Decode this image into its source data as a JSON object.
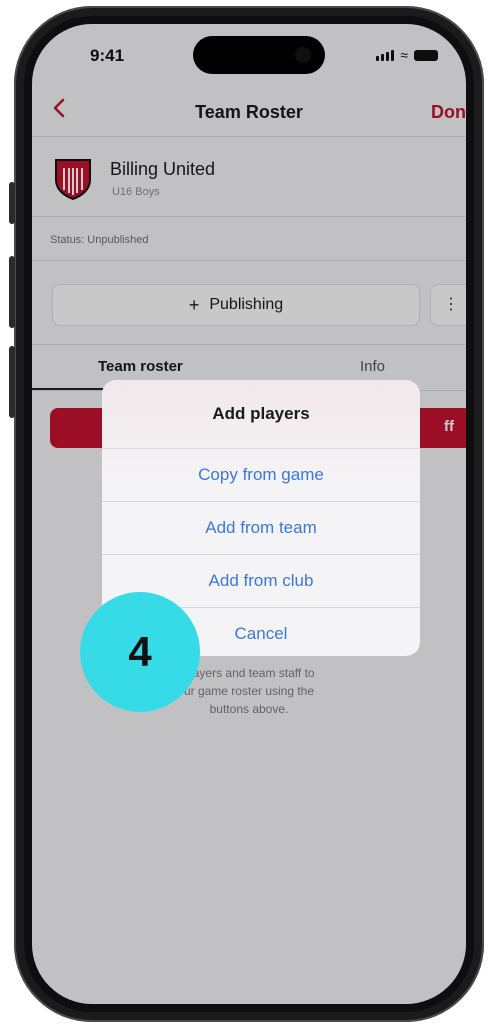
{
  "status_bar": {
    "time": "9:41"
  },
  "nav": {
    "back_icon": "chevron-left-icon",
    "title": "Team Roster",
    "done_label": "Done"
  },
  "team": {
    "name": "Billing United",
    "subtitle": "U16 Boys",
    "status": "Status: Unpublished"
  },
  "actions": {
    "publishing_icon": "+",
    "publishing_label": "Publishing",
    "more_icon": "⋮"
  },
  "tabs": [
    {
      "label": "Team roster"
    },
    {
      "label": "Info"
    }
  ],
  "red_bar_label": "ff",
  "empty_state": {
    "line1": "players and team staff to",
    "line2": "ur game roster using the",
    "line3": "buttons above."
  },
  "sheet": {
    "title": "Add players",
    "items": [
      {
        "label": "Copy from game"
      },
      {
        "label": "Add from team"
      },
      {
        "label": "Add from club"
      },
      {
        "label": "Cancel"
      }
    ]
  },
  "step_badge": "4",
  "colors": {
    "brand_red": "#c4122f",
    "action_blue": "#3d78d6",
    "badge_cyan": "#37dbe8"
  }
}
